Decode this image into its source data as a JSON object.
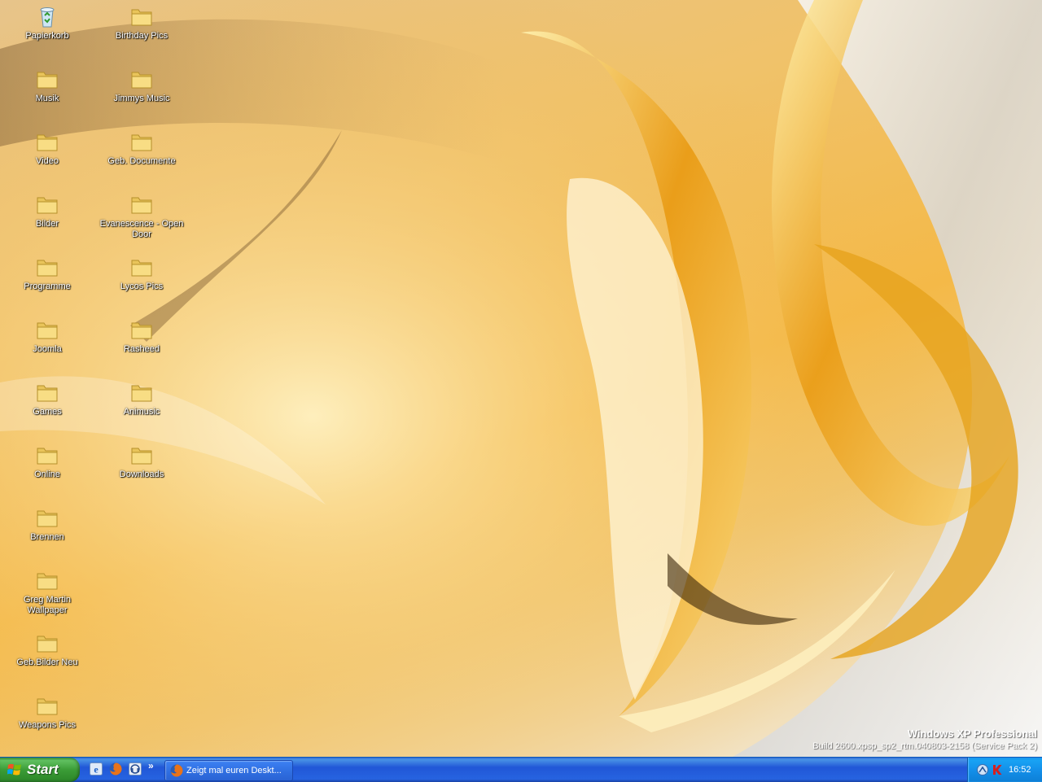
{
  "desktop": {
    "icons": [
      {
        "label": "Papierkorb",
        "icon": "recycle-bin-icon"
      },
      {
        "label": "Birthday Pics",
        "icon": "folder-icon"
      },
      {
        "label": "Musik",
        "icon": "folder-icon"
      },
      {
        "label": "Jimmys Music",
        "icon": "folder-icon"
      },
      {
        "label": "Video",
        "icon": "folder-icon"
      },
      {
        "label": "Geb. Documente",
        "icon": "folder-icon"
      },
      {
        "label": "Bilder",
        "icon": "folder-icon"
      },
      {
        "label": "Evanescence - Open Door",
        "icon": "folder-icon"
      },
      {
        "label": "Programme",
        "icon": "folder-icon"
      },
      {
        "label": "Lycos Pics",
        "icon": "folder-icon"
      },
      {
        "label": "Joomla",
        "icon": "folder-icon"
      },
      {
        "label": "Rasheed",
        "icon": "folder-icon"
      },
      {
        "label": "Games",
        "icon": "folder-icon"
      },
      {
        "label": "Animusic",
        "icon": "folder-icon"
      },
      {
        "label": "Online",
        "icon": "folder-icon"
      },
      {
        "label": "Downloads",
        "icon": "folder-icon"
      },
      {
        "label": "Brennen",
        "icon": "folder-icon"
      },
      {
        "label": "Greg Martin Wallpaper",
        "icon": "folder-icon"
      },
      {
        "label": "Geb.Bilder Neu",
        "icon": "folder-icon"
      },
      {
        "label": "Weapons Pics",
        "icon": "folder-icon"
      }
    ],
    "watermark": {
      "title": "Windows XP Professional",
      "build": "Build 2600.xpsp_sp2_rtm.040803-2158 (Service Pack 2)"
    }
  },
  "taskbar": {
    "start_label": "Start",
    "quick_launch": [
      {
        "icon": "internet-explorer-icon"
      },
      {
        "icon": "firefox-icon"
      },
      {
        "icon": "media-player-icon"
      }
    ],
    "more_label": "»",
    "tasks": [
      {
        "label": "Zeigt mal euren Deskt...",
        "icon": "firefox-icon"
      }
    ],
    "tray_icons": [
      "network-icon",
      "antivirus-icon"
    ],
    "clock": "16:52"
  },
  "colors": {
    "taskbar_blue": "#2157d7",
    "start_green": "#3b9c37",
    "tray_blue": "#1390ea",
    "wallpaper_gold": "#f4b948"
  }
}
